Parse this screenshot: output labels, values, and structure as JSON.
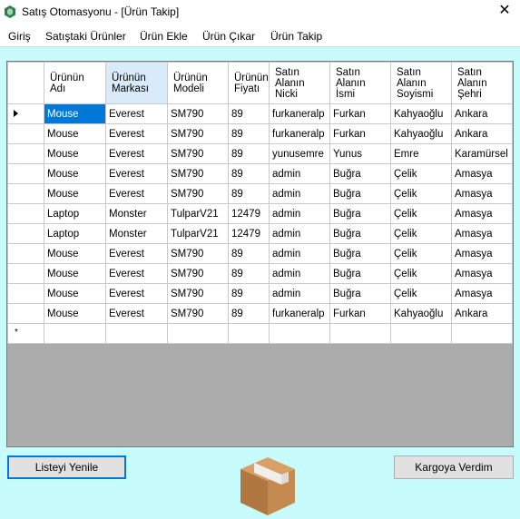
{
  "window": {
    "title": "Satış Otomasyonu - [Ürün Takip]",
    "close_glyph": "✕"
  },
  "menu": [
    {
      "label": "Giriş"
    },
    {
      "label": "Satıştaki Ürünler"
    },
    {
      "label": "Ürün Ekle"
    },
    {
      "label": "Ürün Çıkar"
    },
    {
      "label": "Ürün Takip"
    }
  ],
  "grid": {
    "columns": [
      "Ürünün\nAdı",
      "Ürünün\nMarkası",
      "Ürünün\nModeli",
      "Ürünün\nFiyatı",
      "Satın\nAlanın\nNicki",
      "Satın\nAlanın\nİsmi",
      "Satın\nAlanın\nSoyismi",
      "Satın\nAlanın\nŞehri"
    ],
    "rows": [
      [
        "Mouse",
        "Everest",
        "SM790",
        "89",
        "furkaneralp",
        "Furkan",
        "Kahyaoğlu",
        "Ankara"
      ],
      [
        "Mouse",
        "Everest",
        "SM790",
        "89",
        "furkaneralp",
        "Furkan",
        "Kahyaoğlu",
        "Ankara"
      ],
      [
        "Mouse",
        "Everest",
        "SM790",
        "89",
        "yunusemre",
        "Yunus",
        "Emre",
        "Karamürsel"
      ],
      [
        "Mouse",
        "Everest",
        "SM790",
        "89",
        "admin",
        "Buğra",
        "Çelik",
        "Amasya"
      ],
      [
        "Mouse",
        "Everest",
        "SM790",
        "89",
        "admin",
        "Buğra",
        "Çelik",
        "Amasya"
      ],
      [
        "Laptop",
        "Monster",
        "TulparV21",
        "12479",
        "admin",
        "Buğra",
        "Çelik",
        "Amasya"
      ],
      [
        "Laptop",
        "Monster",
        "TulparV21",
        "12479",
        "admin",
        "Buğra",
        "Çelik",
        "Amasya"
      ],
      [
        "Mouse",
        "Everest",
        "SM790",
        "89",
        "admin",
        "Buğra",
        "Çelik",
        "Amasya"
      ],
      [
        "Mouse",
        "Everest",
        "SM790",
        "89",
        "admin",
        "Buğra",
        "Çelik",
        "Amasya"
      ],
      [
        "Mouse",
        "Everest",
        "SM790",
        "89",
        "admin",
        "Buğra",
        "Çelik",
        "Amasya"
      ],
      [
        "Mouse",
        "Everest",
        "SM790",
        "89",
        "furkaneralp",
        "Furkan",
        "Kahyaoğlu",
        "Ankara"
      ]
    ],
    "selected_cell": {
      "row": 0,
      "col": 0
    },
    "selected_column_header": 1,
    "new_row_glyph": "*"
  },
  "buttons": {
    "refresh": "Listeyi Yenile",
    "cargo": "Kargoya Verdim"
  },
  "icons": {
    "app": "app-icon",
    "box": "cardboard-box-icon"
  },
  "colors": {
    "background": "#c8fcfc",
    "selection": "#0078d7",
    "header_highlight": "#d9ebf9",
    "grid_empty": "#acacac"
  }
}
